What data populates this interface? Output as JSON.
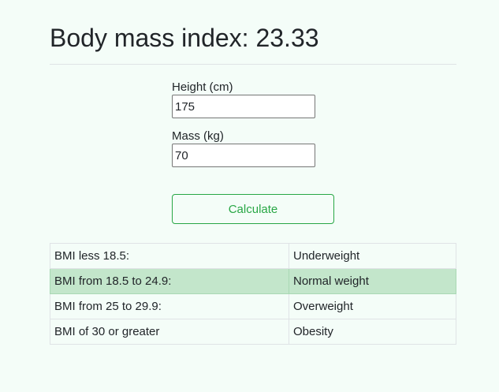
{
  "header": {
    "title": "Body mass index: 23.33"
  },
  "form": {
    "height_label": "Height (cm)",
    "height_value": "175",
    "mass_label": "Mass (kg)",
    "mass_value": "70",
    "calculate_label": "Calculate"
  },
  "table": {
    "rows": [
      {
        "range": "BMI less 18.5:",
        "category": "Underweight",
        "active": false
      },
      {
        "range": "BMI from 18.5 to 24.9:",
        "category": "Normal weight",
        "active": true
      },
      {
        "range": "BMI from 25 to 29.9:",
        "category": "Overweight",
        "active": false
      },
      {
        "range": "BMI of 30 or greater",
        "category": "Obesity",
        "active": false
      }
    ]
  },
  "colors": {
    "background": "#f4fdf8",
    "accent": "#28a745",
    "active_row": "#c3e6cb"
  }
}
